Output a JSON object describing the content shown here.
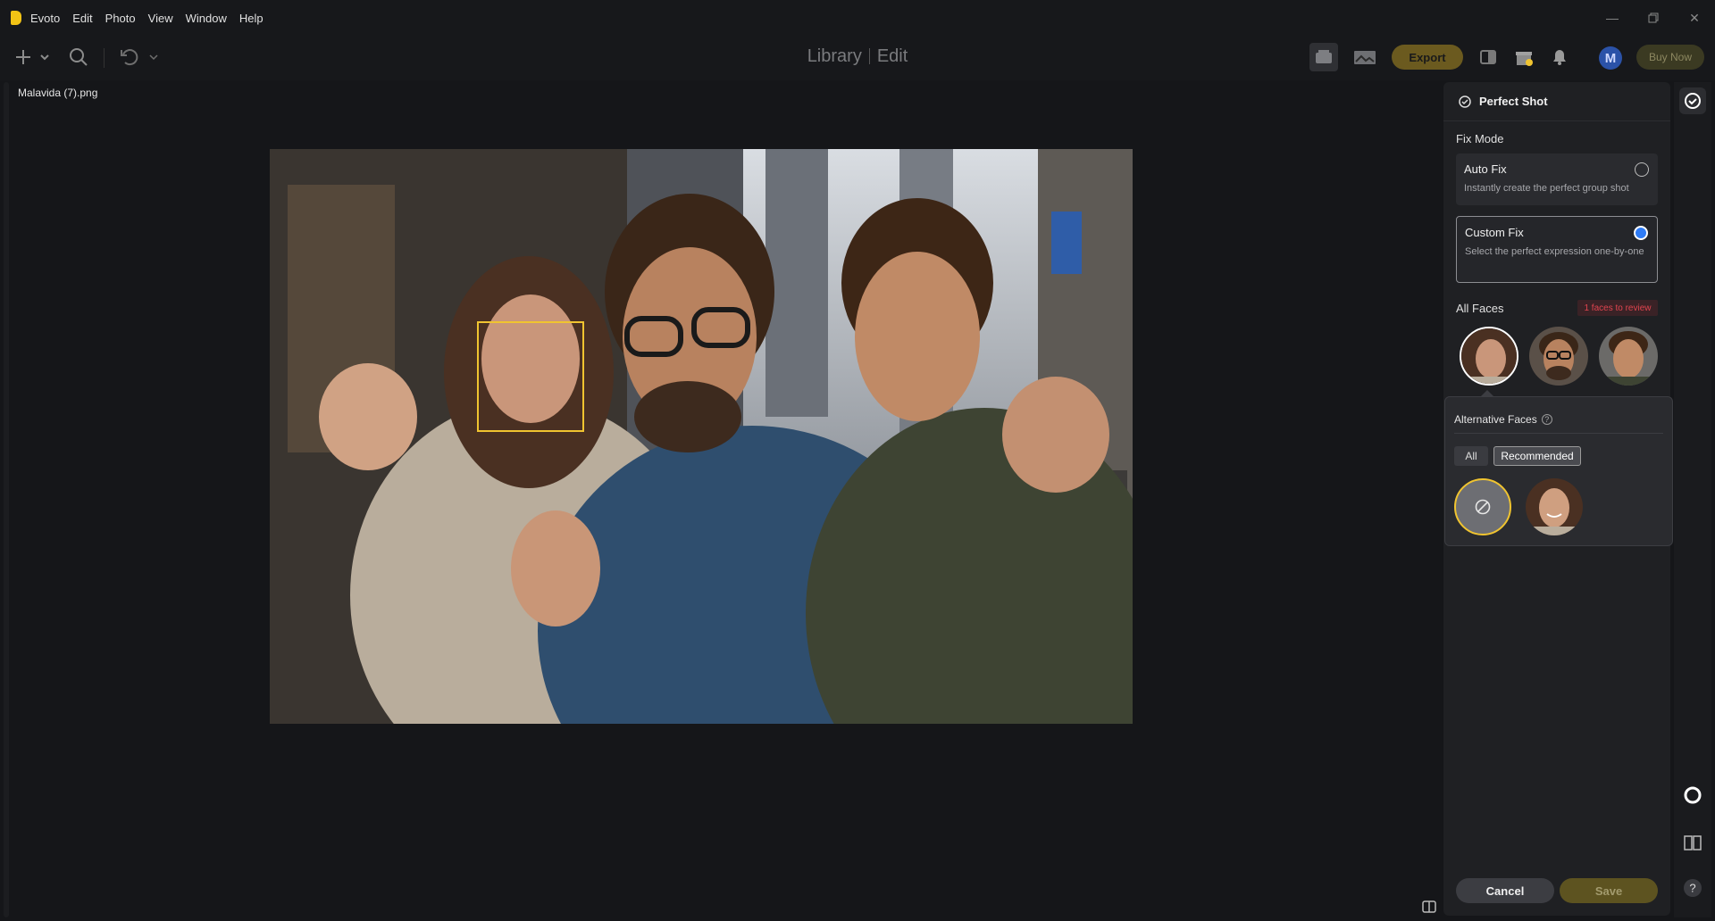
{
  "app": {
    "name": "Evoto",
    "menu": [
      "Edit",
      "Photo",
      "View",
      "Window",
      "Help"
    ]
  },
  "toolbar": {
    "modes": {
      "library": "Library",
      "edit": "Edit"
    },
    "export_label": "Export",
    "buy_label": "Buy Now",
    "avatar_letter": "M"
  },
  "canvas": {
    "filename": "Malavida (7).png"
  },
  "panel": {
    "title": "Perfect Shot",
    "fix_mode_label": "Fix Mode",
    "options": [
      {
        "title": "Auto Fix",
        "desc": "Instantly create the perfect group shot",
        "selected": false
      },
      {
        "title": "Custom Fix",
        "desc": "Select the perfect expression one-by-one",
        "selected": true
      }
    ],
    "all_faces_label": "All Faces",
    "review_badge": "1 faces to review",
    "alternative": {
      "title": "Alternative Faces",
      "help": "?",
      "tabs": {
        "all": "All",
        "recommended": "Recommended"
      }
    },
    "cancel_label": "Cancel",
    "save_label": "Save"
  },
  "colors": {
    "accent": "#f0c430",
    "export_bg": "#6b5a1f",
    "radio_on": "#2f7cf6",
    "review_text": "#e0444f"
  }
}
